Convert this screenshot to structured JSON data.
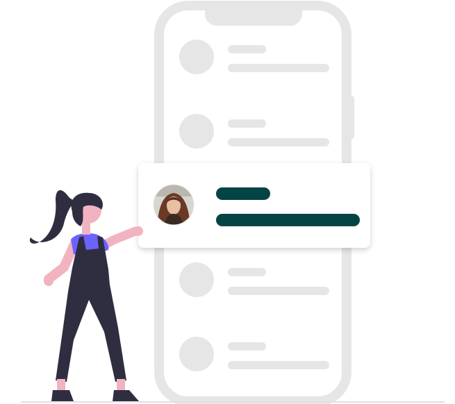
{
  "illustration": {
    "colors": {
      "phone_outline": "#e6e6e6",
      "placeholder": "#e6e6e6",
      "card_background": "#ffffff",
      "accent_bar": "#054445",
      "person_hair": "#2f2e41",
      "person_skin": "#f2b3c1",
      "person_shirt": "#6c63ff",
      "person_overalls": "#2f2e41",
      "ground_line": "#e0e0e0"
    },
    "icons": [
      "phone-frame",
      "avatar-photo",
      "woman-figure"
    ]
  }
}
